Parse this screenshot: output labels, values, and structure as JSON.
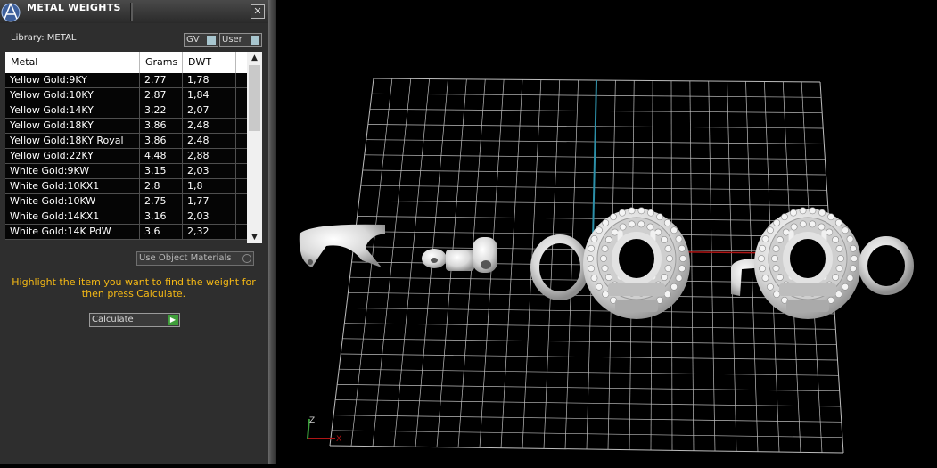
{
  "panel": {
    "title": "METAL WEIGHTS",
    "close_symbol": "✕",
    "library_label": "Library: METAL",
    "toggles": {
      "gv": "GV",
      "user": "User"
    },
    "columns": [
      "Metal",
      "Grams",
      "DWT"
    ],
    "rows": [
      [
        "Yellow Gold:9KY",
        "2.77",
        "1,78"
      ],
      [
        "Yellow Gold:10KY",
        "2.87",
        "1,84"
      ],
      [
        "Yellow Gold:14KY",
        "3.22",
        "2,07"
      ],
      [
        "Yellow Gold:18KY",
        "3.86",
        "2,48"
      ],
      [
        "Yellow Gold:18KY Royal",
        "3.86",
        "2,48"
      ],
      [
        "Yellow Gold:22KY",
        "4.48",
        "2,88"
      ],
      [
        "White Gold:9KW",
        "3.15",
        "2,03"
      ],
      [
        "White Gold:10KX1",
        "2.8",
        "1,8"
      ],
      [
        "White Gold:10KW",
        "2.75",
        "1,77"
      ],
      [
        "White Gold:14KX1",
        "3.16",
        "2,03"
      ],
      [
        "White Gold:14K PdW",
        "3.6",
        "2,32"
      ]
    ],
    "scroll_up": "▲",
    "scroll_down": "▼",
    "use_object_materials": "Use Object Materials",
    "instructions": "Highlight the item you want to find the weight for then press Calculate.",
    "calculate_label": "Calculate",
    "calculate_icon": "▶"
  },
  "viewport": {
    "axis_labels": {
      "z": "Z",
      "x": "X"
    }
  },
  "colors": {
    "instruction_text": "#f5b915",
    "grid": "#bdbdbd",
    "axis_blue": "#2c8fa8",
    "axis_red": "#b01515",
    "model": "#e6e6e6"
  }
}
